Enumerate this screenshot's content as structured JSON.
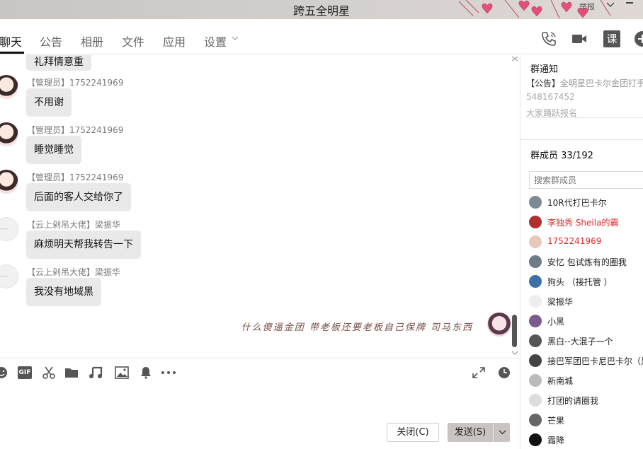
{
  "window": {
    "title": "跨五全明星",
    "report_label": "举报"
  },
  "tabs": [
    {
      "label": "聊天",
      "active": true
    },
    {
      "label": "公告",
      "active": false
    },
    {
      "label": "相册",
      "active": false
    },
    {
      "label": "文件",
      "active": false
    },
    {
      "label": "应用",
      "active": false
    },
    {
      "label": "设置",
      "active": false
    }
  ],
  "header_icons": [
    "phone-icon",
    "video-call-icon",
    "class-icon",
    "add-icon"
  ],
  "header_class_label": "课",
  "messages": [
    {
      "sender": "",
      "text": "礼拜情意重",
      "avatar": "anime",
      "partial": true
    },
    {
      "sender": "【管理员】1752241969",
      "text": "不用谢",
      "avatar": "anime"
    },
    {
      "sender": "【管理员】1752241969",
      "text": "睡觉睡觉",
      "avatar": "anime"
    },
    {
      "sender": "【管理员】1752241969",
      "text": "后面的客人交给你了",
      "avatar": "anime"
    },
    {
      "sender": "【云上剁吊大佬】梁振华",
      "text": "麻烦明天帮我转告一下",
      "avatar": "blank"
    },
    {
      "sender": "【云上剁吊大佬】梁振华",
      "text": "我没有地域黑",
      "avatar": "blank"
    }
  ],
  "self_message": "什么傻逼金团 带老板还要老板自己保牌 司马东西",
  "toolbar_icons": [
    "emoji-icon",
    "gif-icon",
    "scissors-icon",
    "folder-icon",
    "music-icon",
    "image-icon",
    "bell-icon",
    "more-icon",
    "expand-icon",
    "history-icon"
  ],
  "toolbar_gif_label": "GIF",
  "buttons": {
    "close": "关闭(C)",
    "send": "发送(S)"
  },
  "notice": {
    "title": "群通知",
    "line1_prefix": "【公告】",
    "line1_rest": "全明星巴卡尔金团打手",
    "line2": "548167452",
    "line3": "大家踊跃报名"
  },
  "members": {
    "title": "群成员 33/192",
    "search_placeholder": "搜索群成员",
    "list": [
      {
        "name": "10R代打巴卡尔",
        "red": false,
        "color": "#7d8a93"
      },
      {
        "name": "李独秀  Sheila的霸",
        "red": true,
        "color": "#b03030"
      },
      {
        "name": "1752241969",
        "red": true,
        "color": "#e8c9b9"
      },
      {
        "name": "安忆   包试炼有的圈我",
        "red": false,
        "color": "#6f7b86"
      },
      {
        "name": "狗头 （接托管 ）",
        "red": false,
        "color": "#3b6fa8"
      },
      {
        "name": "梁振华",
        "red": false,
        "color": "#eeeeee"
      },
      {
        "name": "小黑",
        "red": false,
        "color": "#7a5a8f"
      },
      {
        "name": "黑白--大混子一个",
        "red": false,
        "color": "#555555"
      },
      {
        "name": "接巴军团巴卡尼巴卡尔（是",
        "red": false,
        "color": "#444444"
      },
      {
        "name": "新南城",
        "red": false,
        "color": "#bbbbbb"
      },
      {
        "name": "打团的请圈我",
        "red": false,
        "color": "#dddddd"
      },
      {
        "name": "芒果",
        "red": false,
        "color": "#666666"
      },
      {
        "name": "霜降",
        "red": false,
        "color": "#111111"
      }
    ]
  }
}
